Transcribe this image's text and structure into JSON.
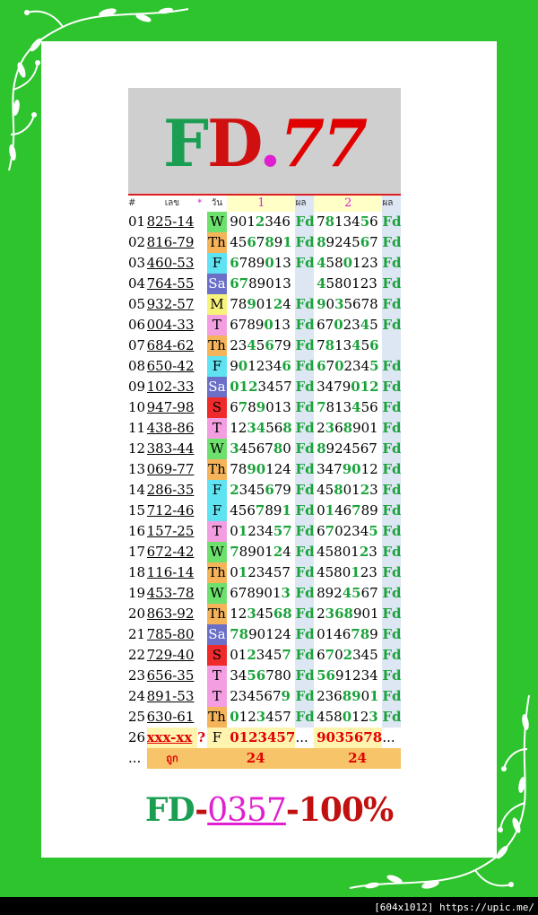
{
  "logo": {
    "part1": "F",
    "part2": "D",
    "dot": ".",
    "part3": "77"
  },
  "table": {
    "headers": {
      "no": "#",
      "number": "เลข",
      "star": "*",
      "day": "วัน",
      "set1": "1",
      "res1": "ผล",
      "set2": "2",
      "res2": "ผล"
    },
    "rows": [
      {
        "no": "01",
        "number": "825-14",
        "day": "W",
        "set1": "9012346",
        "res1": "Fd",
        "set2": "7813456",
        "res2": "Fd"
      },
      {
        "no": "02",
        "number": "816-79",
        "day": "Th",
        "set1": "4567891",
        "res1": "Fd",
        "set2": "8924567",
        "res2": "Fd"
      },
      {
        "no": "03",
        "number": "460-53",
        "day": "F",
        "set1": "6789013",
        "res1": "Fd",
        "set2": "4580123",
        "res2": "Fd"
      },
      {
        "no": "04",
        "number": "764-55",
        "day": "Sa",
        "set1": "6789013",
        "res1": "",
        "set2": "4580123",
        "res2": "Fd"
      },
      {
        "no": "05",
        "number": "932-57",
        "day": "M",
        "set1": "7890124",
        "res1": "Fd",
        "set2": "9035678",
        "res2": "Fd"
      },
      {
        "no": "06",
        "number": "004-33",
        "day": "T",
        "set1": "6789013",
        "res1": "Fd",
        "set2": "6702345",
        "res2": "Fd"
      },
      {
        "no": "07",
        "number": "684-62",
        "day": "Th",
        "set1": "2345679",
        "res1": "Fd",
        "set2": "7813456",
        "res2": ""
      },
      {
        "no": "08",
        "number": "650-42",
        "day": "F",
        "set1": "9012346",
        "res1": "Fd",
        "set2": "6702345",
        "res2": "Fd"
      },
      {
        "no": "09",
        "number": "102-33",
        "day": "Sa",
        "set1": "0123457",
        "res1": "Fd",
        "set2": "3479012",
        "res2": "Fd"
      },
      {
        "no": "10",
        "number": "947-98",
        "day": "S",
        "set1": "6789013",
        "res1": "Fd",
        "set2": "7813456",
        "res2": "Fd"
      },
      {
        "no": "11",
        "number": "438-86",
        "day": "T",
        "set1": "1234568",
        "res1": "Fd",
        "set2": "2368901",
        "res2": "Fd"
      },
      {
        "no": "12",
        "number": "383-44",
        "day": "W",
        "set1": "3456780",
        "res1": "Fd",
        "set2": "8924567",
        "res2": "Fd"
      },
      {
        "no": "13",
        "number": "069-77",
        "day": "Th",
        "set1": "7890124",
        "res1": "Fd",
        "set2": "3479012",
        "res2": "Fd"
      },
      {
        "no": "14",
        "number": "286-35",
        "day": "F",
        "set1": "2345679",
        "res1": "Fd",
        "set2": "4580123",
        "res2": "Fd"
      },
      {
        "no": "15",
        "number": "712-46",
        "day": "F",
        "set1": "4567891",
        "res1": "Fd",
        "set2": "0146789",
        "res2": "Fd"
      },
      {
        "no": "16",
        "number": "157-25",
        "day": "T",
        "set1": "0123457",
        "res1": "Fd",
        "set2": "6702345",
        "res2": "Fd"
      },
      {
        "no": "17",
        "number": "672-42",
        "day": "W",
        "set1": "7890124",
        "res1": "Fd",
        "set2": "4580123",
        "res2": "Fd"
      },
      {
        "no": "18",
        "number": "116-14",
        "day": "Th",
        "set1": "0123457",
        "res1": "Fd",
        "set2": "4580123",
        "res2": "Fd"
      },
      {
        "no": "19",
        "number": "453-78",
        "day": "W",
        "set1": "6789013",
        "res1": "Fd",
        "set2": "8924567",
        "res2": "Fd"
      },
      {
        "no": "20",
        "number": "863-92",
        "day": "Th",
        "set1": "1234568",
        "res1": "Fd",
        "set2": "2368901",
        "res2": "Fd"
      },
      {
        "no": "21",
        "number": "785-80",
        "day": "Sa",
        "set1": "7890124",
        "res1": "Fd",
        "set2": "0146789",
        "res2": "Fd"
      },
      {
        "no": "22",
        "number": "729-40",
        "day": "S",
        "set1": "0123457",
        "res1": "Fd",
        "set2": "6702345",
        "res2": "Fd"
      },
      {
        "no": "23",
        "number": "656-35",
        "day": "T",
        "set1": "3456780",
        "res1": "Fd",
        "set2": "5691234",
        "res2": "Fd"
      },
      {
        "no": "24",
        "number": "891-53",
        "day": "T",
        "set1": "2345679",
        "res1": "Fd",
        "set2": "2368901",
        "res2": "Fd"
      },
      {
        "no": "25",
        "number": "630-61",
        "day": "Th",
        "set1": "0123457",
        "res1": "Fd",
        "set2": "4580123",
        "res2": "Fd"
      }
    ],
    "next_row": {
      "no": "26",
      "number": "xxx-xx",
      "q": "?",
      "day": "F",
      "set1": "0123457",
      "res1": "...",
      "set2": "9035678",
      "res2": "..."
    },
    "summary_row": {
      "dots": "...",
      "label": "ถูก",
      "count1": "24",
      "count2": "24"
    }
  },
  "footer": {
    "part1": "FD",
    "dash1": "-",
    "digits": "0357",
    "dash2": "-",
    "rate": "100%"
  },
  "credit": "[604x1012] https://upic.me/",
  "colors": {
    "frame": "#2ec42e",
    "card": "#ffffff",
    "header_bg": "#cfcfcf",
    "hit_green": "#1aa33a",
    "accent_red": "#e00000",
    "accent_magenta": "#e020d0"
  }
}
